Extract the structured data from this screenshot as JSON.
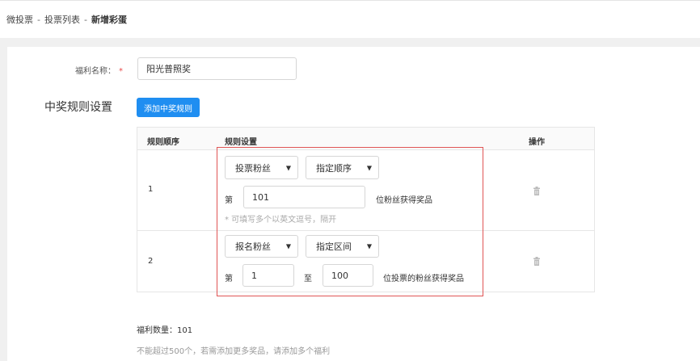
{
  "breadcrumb": {
    "item1": "微投票",
    "sep": "-",
    "item2": "投票列表",
    "current": "新增彩蛋"
  },
  "form": {
    "welfare_name_label": "福利名称：",
    "required_mark": "*",
    "welfare_name_value": "阳光普照奖",
    "rules_section_title": "中奖规则设置",
    "add_rule_button": "添加中奖规则"
  },
  "table": {
    "headers": {
      "order": "规则顺序",
      "setting": "规则设置",
      "action": "操作"
    },
    "rows": [
      {
        "order": "1",
        "fan_type": "投票粉丝",
        "mode": "指定顺序",
        "prefix": "第",
        "value": "101",
        "suffix": "位粉丝获得奖品",
        "hint": "* 可填写多个以英文逗号，隔开"
      },
      {
        "order": "2",
        "fan_type": "报名粉丝",
        "mode": "指定区间",
        "prefix": "第",
        "from": "1",
        "to_label": "至",
        "to": "100",
        "suffix": "位投票的粉丝获得奖品"
      }
    ]
  },
  "summary": {
    "count_label": "福利数量：101",
    "note": "不能超过500个，若需添加更多奖品，请添加多个福利"
  },
  "colors": {
    "primary": "#1f8ef1",
    "highlight_border": "#e05555",
    "required": "#e94b4b"
  }
}
